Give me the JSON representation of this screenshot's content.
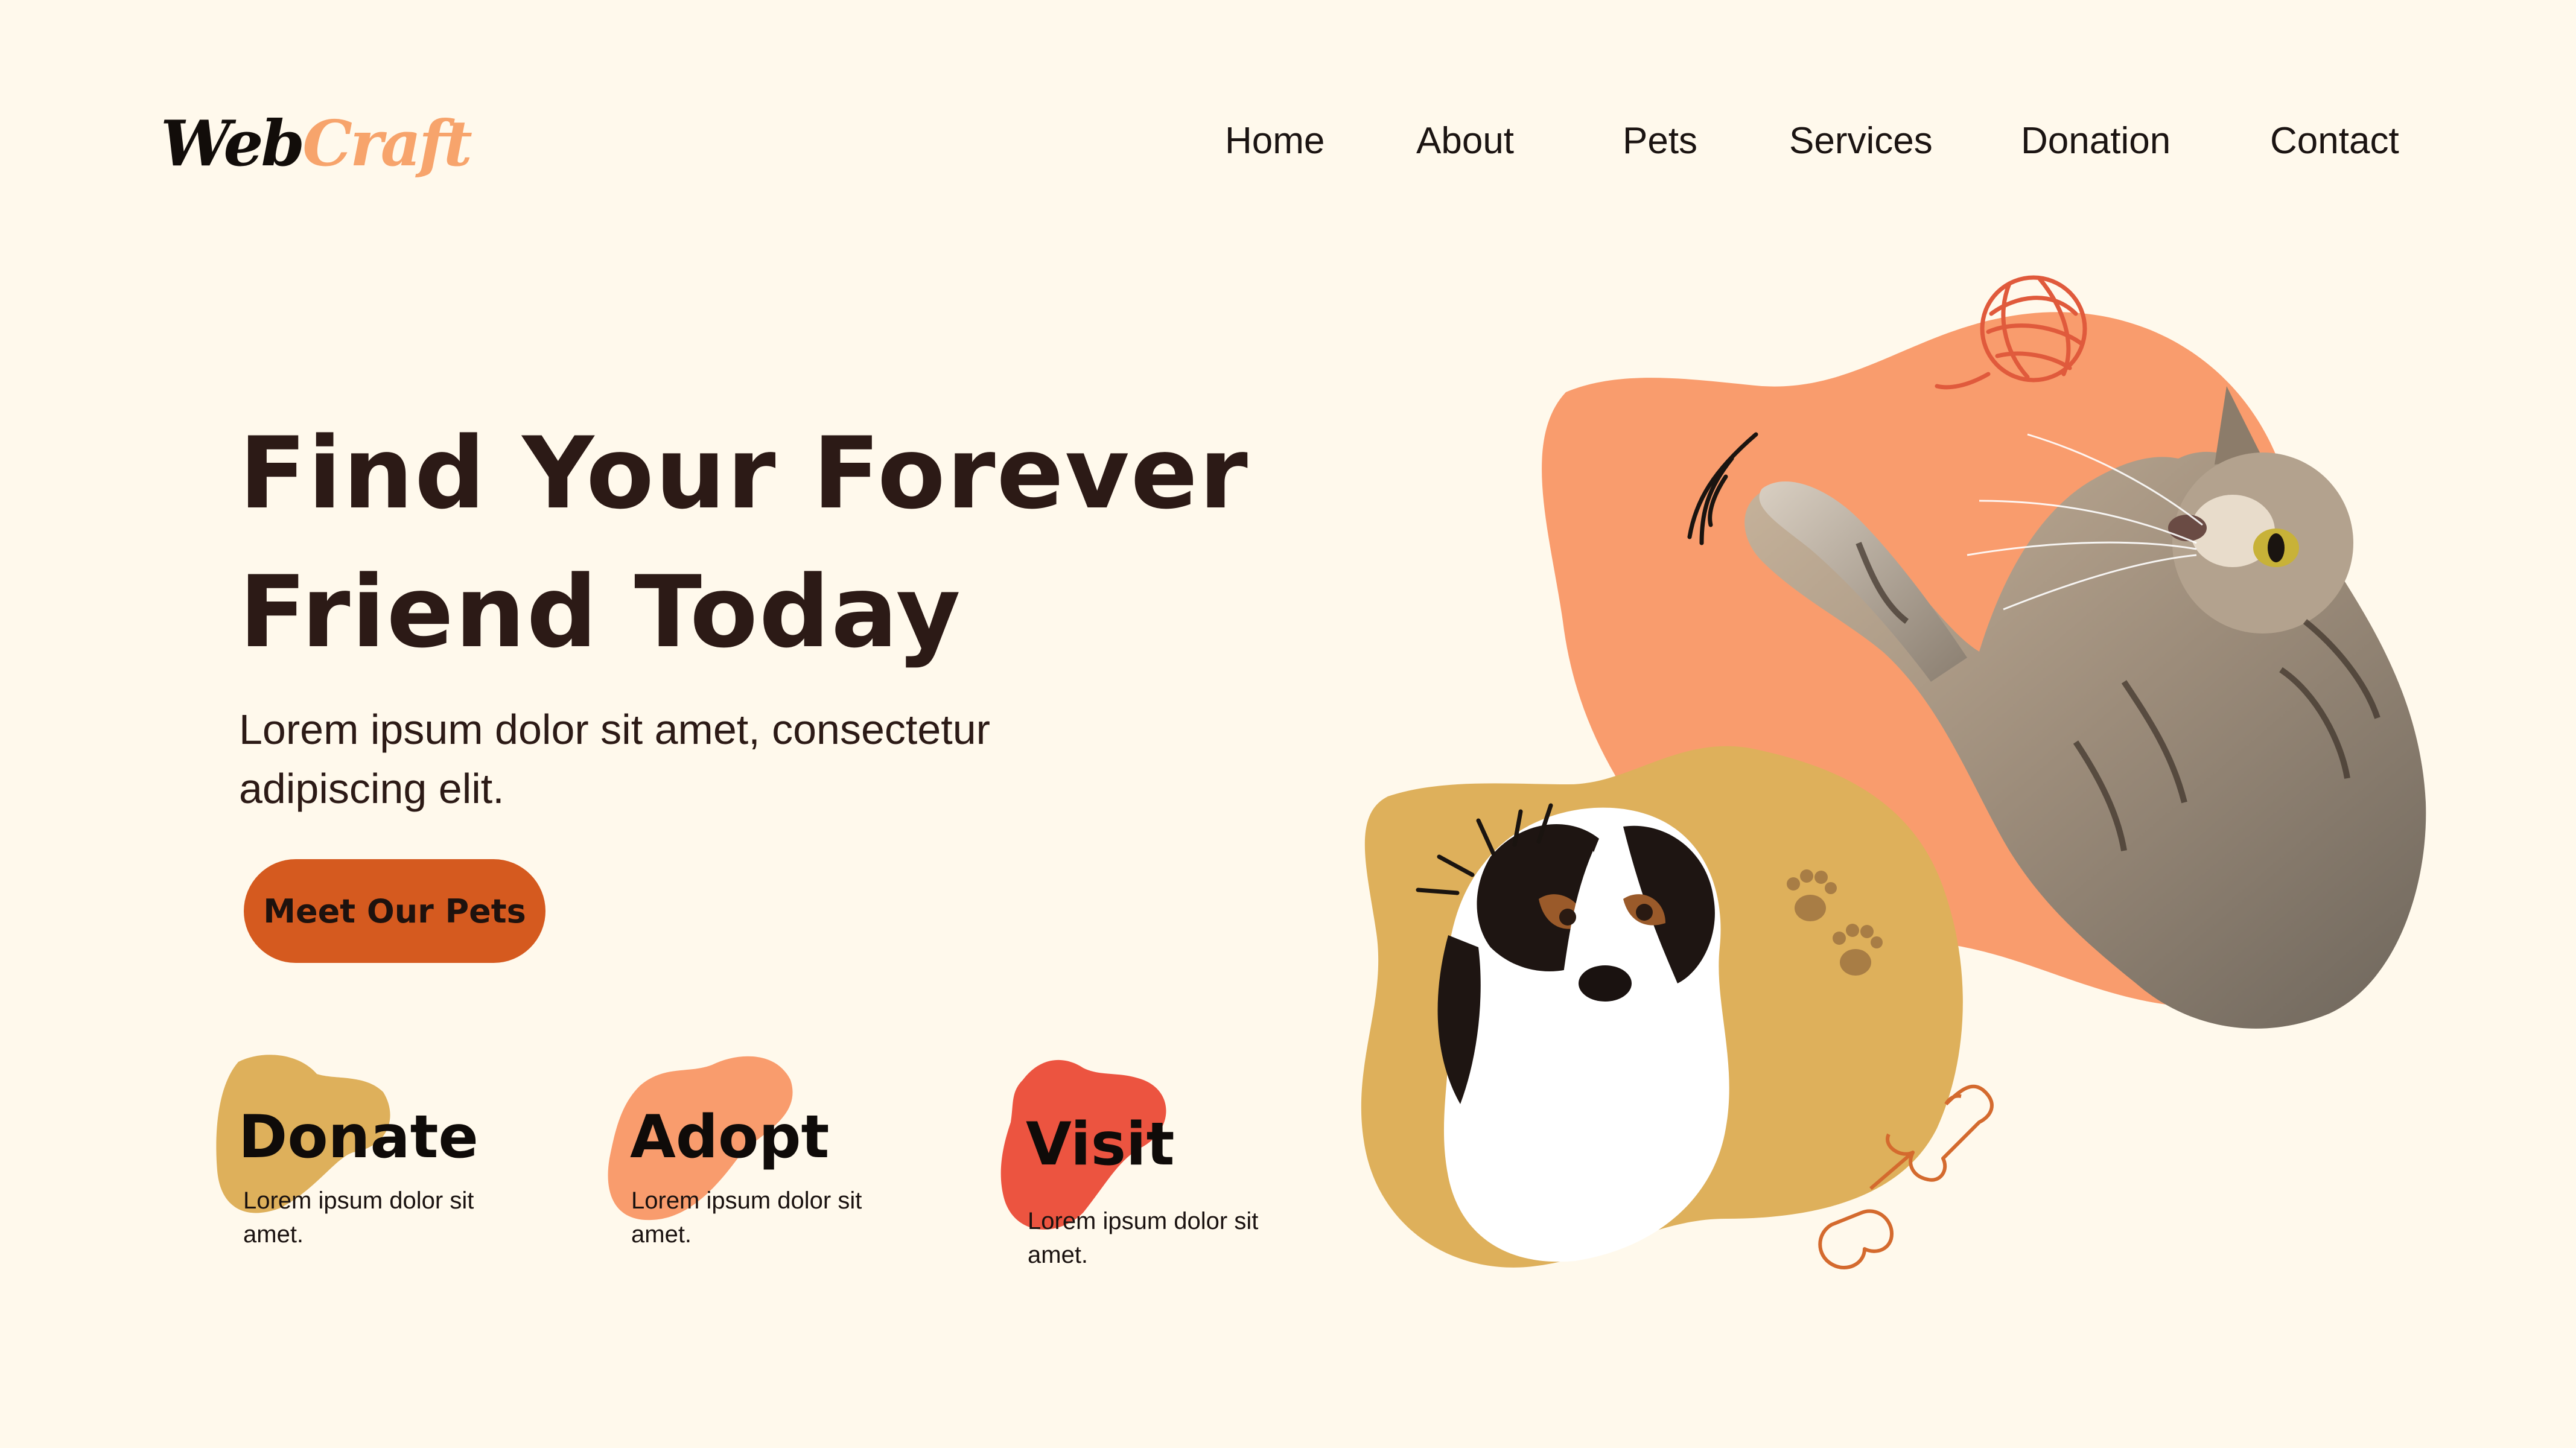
{
  "brand": {
    "part1": "Web",
    "part2": "Craft"
  },
  "nav": {
    "items": [
      {
        "label": "Home"
      },
      {
        "label": "About"
      },
      {
        "label": "Pets"
      },
      {
        "label": "Services"
      },
      {
        "label": "Donation"
      },
      {
        "label": "Contact"
      }
    ]
  },
  "hero": {
    "title_line1": "Find Your Forever",
    "title_line2": "Friend Today",
    "subtitle_line1": "Lorem ipsum dolor sit amet, consectetur",
    "subtitle_line2": "adipiscing elit.",
    "cta_label": "Meet Our Pets"
  },
  "features": [
    {
      "title": "Donate",
      "text_line1": "Lorem ipsum dolor sit",
      "text_line2": "amet."
    },
    {
      "title": "Adopt",
      "text_line1": "Lorem ipsum dolor sit",
      "text_line2": "amet."
    },
    {
      "title": "Visit",
      "text_line1": "Lorem ipsum dolor sit",
      "text_line2": "amet."
    }
  ],
  "colors": {
    "background": "#FFF9EC",
    "text": "#2C1A16",
    "brand_accent": "#F7A46C",
    "button": "#D55A1F",
    "blob_orange": "#F99C6D",
    "blob_mustard": "#DEB05B",
    "blob_red": "#EC5440"
  },
  "icons": [
    "yarn-ball-icon",
    "paw-print-icon",
    "bone-icon",
    "motion-lines-icon"
  ]
}
